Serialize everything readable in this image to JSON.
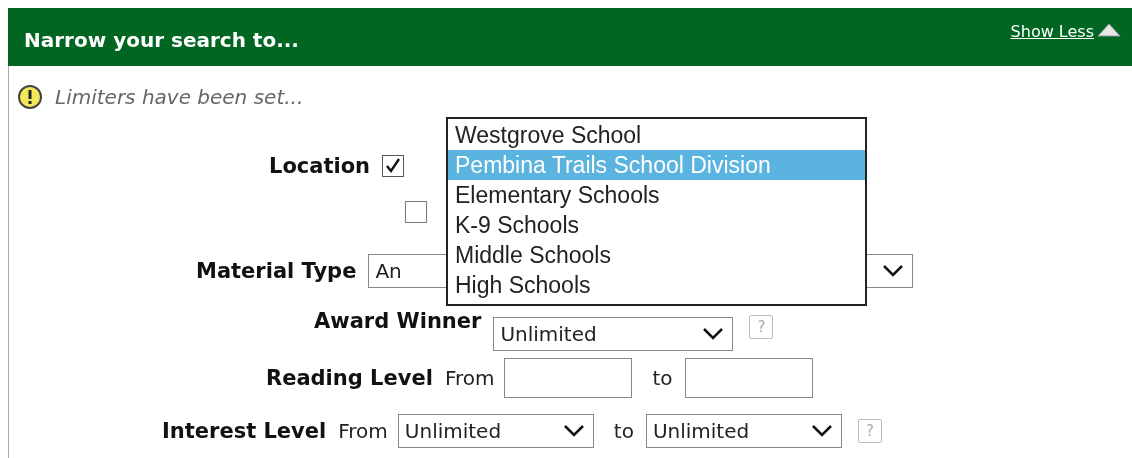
{
  "header": {
    "title": "Narrow your search to...",
    "toggle_link": "Show Less"
  },
  "notice": {
    "text": "Limiters have been set..."
  },
  "location": {
    "label": "Location",
    "checkboxes": [
      {
        "checked": true
      },
      {
        "checked": false
      }
    ]
  },
  "material_type": {
    "label": "Material Type",
    "value": "An"
  },
  "award_winner": {
    "label": "Award Winner",
    "value": "Unlimited",
    "help": "?"
  },
  "reading_level": {
    "label": "Reading Level",
    "from_label": "From",
    "to_label": "to"
  },
  "interest_level": {
    "label": "Interest Level",
    "from_label": "From",
    "from_value": "Unlimited",
    "to_label": "to",
    "to_value": "Unlimited",
    "help": "?"
  },
  "location_dropdown": {
    "options": [
      {
        "label": "Westgrove School",
        "selected": false
      },
      {
        "label": "Pembina Trails School Division",
        "selected": true
      },
      {
        "label": "Elementary Schools",
        "selected": false
      },
      {
        "label": "K-9 Schools",
        "selected": false
      },
      {
        "label": "Middle Schools",
        "selected": false
      },
      {
        "label": "High Schools",
        "selected": false
      }
    ]
  }
}
